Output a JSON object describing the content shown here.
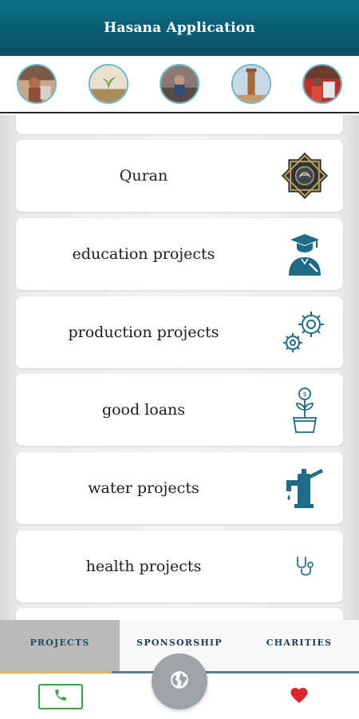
{
  "app_bar": {
    "title": "Hasana Application"
  },
  "stories": [
    {
      "icon": "story-thumbnail-1"
    },
    {
      "icon": "story-thumbnail-2"
    },
    {
      "icon": "story-thumbnail-3"
    },
    {
      "icon": "story-thumbnail-4"
    },
    {
      "icon": "story-thumbnail-5"
    }
  ],
  "categories": [
    {
      "label": "Quran",
      "icon": "quran-icon"
    },
    {
      "label": "education projects",
      "icon": "graduate-icon"
    },
    {
      "label": "production projects",
      "icon": "gears-icon"
    },
    {
      "label": "good loans",
      "icon": "money-plant-icon"
    },
    {
      "label": "water projects",
      "icon": "water-pump-icon"
    },
    {
      "label": "health projects",
      "icon": "stethoscope-icon"
    }
  ],
  "tabs": [
    {
      "label": "PROJECTS",
      "active": true
    },
    {
      "label": "SPONSORSHIP",
      "active": false
    },
    {
      "label": "CHARITIES",
      "active": false
    }
  ],
  "bottom": {
    "phone_icon": "phone-icon",
    "fab_icon": "globe-icon",
    "heart_icon": "heart-icon"
  },
  "colors": {
    "app_bar": "#0b5d74",
    "icon_teal": "#1f6b86",
    "active_tab": "#b7b9bb",
    "phone_green": "#3aa24a",
    "heart_red": "#e0242a",
    "tab_accent": "#e2b454"
  }
}
